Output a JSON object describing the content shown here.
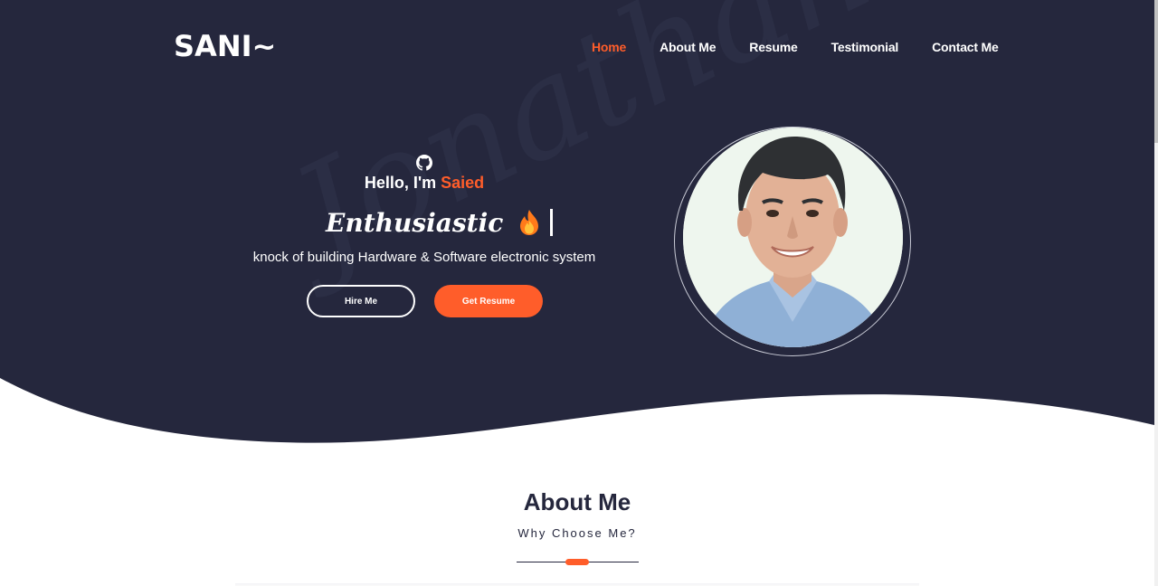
{
  "brand": {
    "logo": "SANI~"
  },
  "nav": {
    "items": [
      {
        "label": "Home",
        "active": true
      },
      {
        "label": "About Me"
      },
      {
        "label": "Resume"
      },
      {
        "label": "Testimonial"
      },
      {
        "label": "Contact Me"
      }
    ]
  },
  "hero": {
    "greeting_prefix": "Hello, I'm ",
    "greeting_name": "Saied",
    "typed_word": "Enthusiastic",
    "tagline": "knock of building Hardware & Software electronic system",
    "hire_button": "Hire Me",
    "resume_button": "Get Resume",
    "watermark": "Jonathan Do",
    "icons": [
      "github-icon",
      "flame-icon"
    ]
  },
  "about": {
    "title": "About Me",
    "subtitle": "Why Choose Me?"
  },
  "colors": {
    "hero_bg": "#25273d",
    "accent": "#ff5d2a",
    "text_light": "#ffffff",
    "text_dark": "#25273d"
  }
}
